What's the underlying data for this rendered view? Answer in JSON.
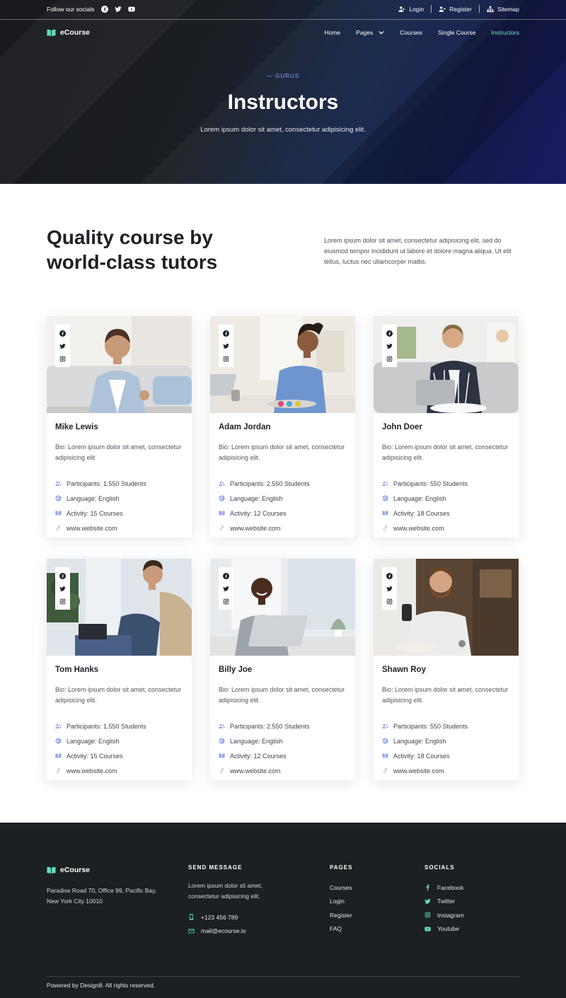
{
  "topbar": {
    "follow_label": "Follow our socials",
    "social_icons": [
      "facebook-icon",
      "twitter-icon",
      "youtube-icon"
    ],
    "login": "Login",
    "register": "Register",
    "sitemap": "Sitemap"
  },
  "navbar": {
    "brand": "eCourse",
    "items": [
      {
        "label": "Home"
      },
      {
        "label": "Pages"
      },
      {
        "label": "Courses"
      },
      {
        "label": "Single Course"
      },
      {
        "label": "Instructors"
      }
    ],
    "active_color": "#6fe6c5"
  },
  "hero": {
    "kicker": "— GURUS",
    "title": "Instructors",
    "subtitle": "Lorem ipsum dolor sit amet, consectetur adipisicing elit."
  },
  "intro": {
    "heading": "Quality course by world-class tutors",
    "text": "Lorem ipsum dolor sit amet, consectetur adipisicing elit, sed do eiusmod tempor incididunt ut labore et dolore magna aliqua. Ut elit tellus, luctus nec ullamcorper mattis."
  },
  "instructors": [
    {
      "name": "Mike Lewis",
      "bio": "Bio: Lorem ipsum dolor sit amet, consectetur adipisicing elit",
      "participants": "Participants: 1.550 Students",
      "language": "Language: English",
      "activity": "Activity: 15 Courses",
      "website": "www.website.com"
    },
    {
      "name": "Adam Jordan",
      "bio": "Bio: Lorem ipsum dolor sit amet, consectetur adipisicing elit.",
      "participants": "Participants: 2.550 Students",
      "language": "Language: English",
      "activity": "Activity: 12 Courses",
      "website": "www.website.com"
    },
    {
      "name": "John Doer",
      "bio": "Bio: Lorem ipsum dolor sit amet, consectetur adipisicing elit.",
      "participants": "Participants: 550 Students",
      "language": "Language: English",
      "activity": "Activity: 18 Courses",
      "website": "www.website.com"
    },
    {
      "name": "Tom Hanks",
      "bio": "Bio: Lorem ipsum dolor sit amet, consectetur adipisicing elit.",
      "participants": "Participants: 1.550 Students",
      "language": "Language: English",
      "activity": "Activity: 15 Courses",
      "website": "www.website.com"
    },
    {
      "name": "Billy Joe",
      "bio": "Bio: Lorem ipsum dolor sit amet, consectetur adipisicing elit.",
      "participants": "Participants: 2.550 Students",
      "language": "Language: English",
      "activity": "Activity: 12 Courses",
      "website": "www.website.com"
    },
    {
      "name": "Shawn Roy",
      "bio": "Bio: Lorem ipsum dolor sit amet, consectetur adipisicing elit.",
      "participants": "Participants: 550 Students",
      "language": "Language: English",
      "activity": "Activity: 18 Courses",
      "website": "www.website.com"
    }
  ],
  "footer": {
    "brand": "eCourse",
    "address": "Paradise Road 70, Office 99, Pacific Bay,  New York City 10010",
    "send_message": {
      "heading": "SEND MESSAGE",
      "text": "Lorem ipsum dolor sit amet, consectetur adipisicing elit.",
      "phone": "+123 456 789",
      "email": "mail@ecourse.io"
    },
    "pages": {
      "heading": "PAGES",
      "links": [
        "Courses",
        "Login",
        "Register",
        "FAQ"
      ]
    },
    "socials": {
      "heading": "SOCIALS",
      "links": [
        "Facebook",
        "Twitter",
        "Instagram",
        "Youtube"
      ]
    },
    "copyright": "Powered by Design8. All rights reserved.",
    "accent_color": "#5fe0bd"
  }
}
